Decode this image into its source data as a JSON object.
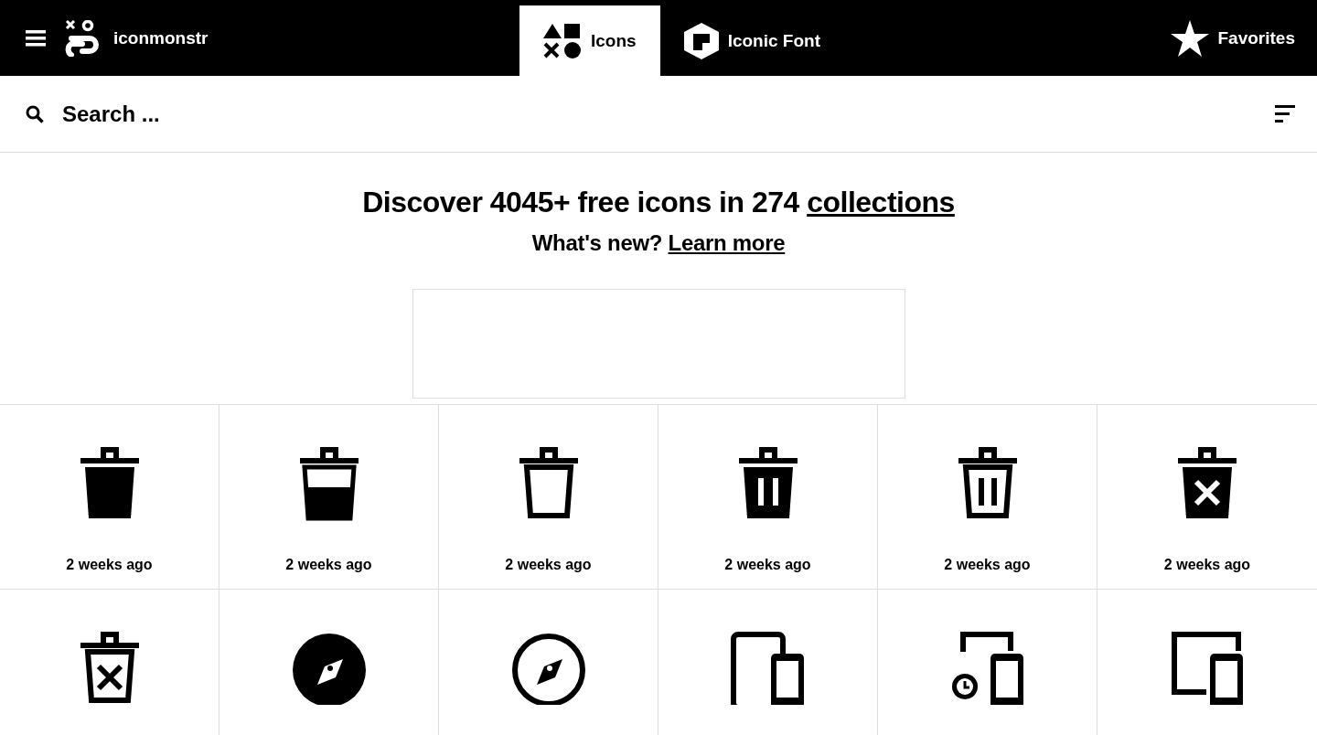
{
  "header": {
    "brand": "iconmonstr",
    "tabs": [
      {
        "label": "Icons",
        "kind": "shapes",
        "selected": true
      },
      {
        "label": "Iconic Font",
        "kind": "hexagon",
        "selected": false
      }
    ],
    "favorites": "Favorites"
  },
  "search": {
    "placeholder": "Search ..."
  },
  "hero": {
    "title": "Discover 4045+ free icons in 274 ",
    "title_link": "collections",
    "subtitle": "What's new? ",
    "subtitle_link": "Learn more"
  },
  "icons": [
    {
      "kind": "trash-filled",
      "time": "2 weeks ago"
    },
    {
      "kind": "trash-half",
      "time": "2 weeks ago"
    },
    {
      "kind": "trash-outline",
      "time": "2 weeks ago"
    },
    {
      "kind": "trash-bars",
      "time": "2 weeks ago"
    },
    {
      "kind": "trash-bars-outline",
      "time": "2 weeks ago"
    },
    {
      "kind": "trash-x",
      "time": "2 weeks ago"
    },
    {
      "kind": "trash-x-outline"
    },
    {
      "kind": "compass-filled"
    },
    {
      "kind": "compass-outline"
    },
    {
      "kind": "tablet-phone"
    },
    {
      "kind": "watch-phone"
    },
    {
      "kind": "monitor-phone"
    }
  ]
}
